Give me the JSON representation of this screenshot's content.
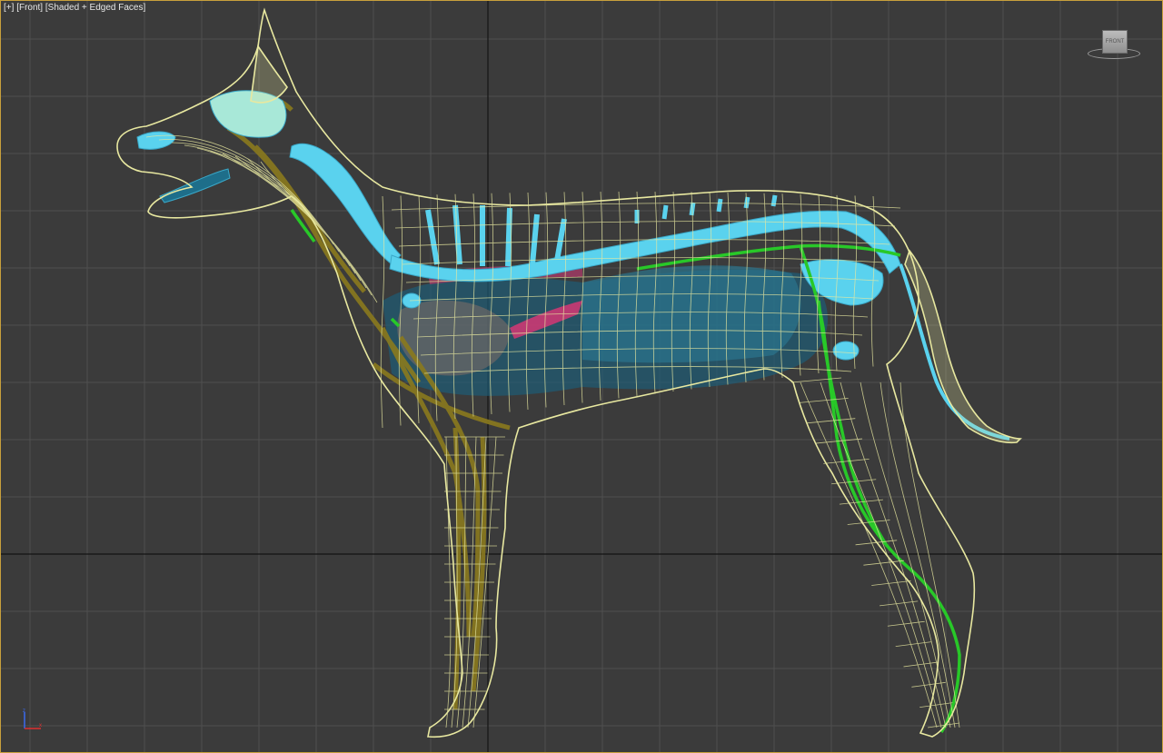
{
  "viewport": {
    "label_plus": "[+]",
    "label_view": "[Front]",
    "label_shading": "[Shaded + Edged Faces]",
    "viewcube_face": "FRONT"
  },
  "colors": {
    "background": "#3b3b3b",
    "grid": "#4e4e4e",
    "axis_line": "#111111",
    "wireframe": "#e8e8a0",
    "skeleton": "#5ad2ee",
    "muscle": "#8a7a1e",
    "nerve": "#28c828",
    "organ_dark": "#1e6e8a",
    "organ_pink": "#c83c78",
    "border": "#c8a03c"
  },
  "icons": {
    "viewcube": "viewcube-icon",
    "axis": "axis-tripod-icon"
  }
}
